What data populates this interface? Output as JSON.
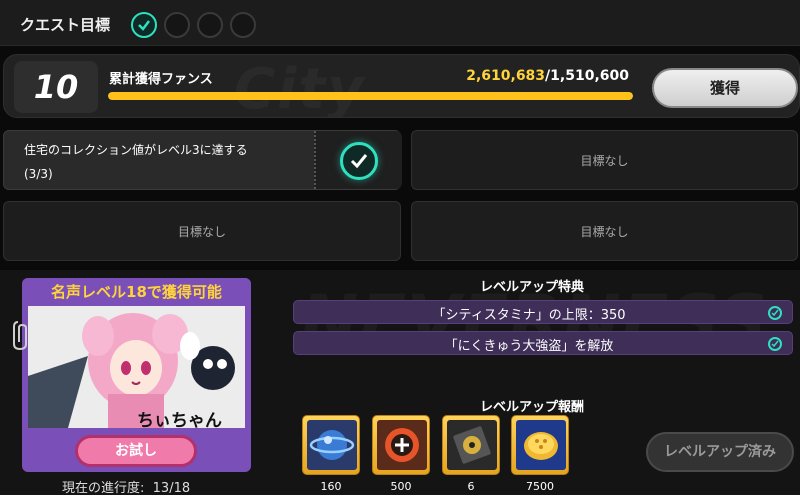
{
  "quest": {
    "title": "クエスト目標",
    "dots": [
      {
        "state": "completed",
        "icon": "check-icon"
      },
      {
        "state": "empty"
      },
      {
        "state": "empty"
      },
      {
        "state": "empty"
      }
    ]
  },
  "fans": {
    "level": "10",
    "label": "累計獲得ファンス",
    "current": "2,610,683",
    "required": "/1,510,600",
    "progress": 1.0,
    "claim_label": "獲得",
    "accent_color": "#ffc21a"
  },
  "goals": [
    {
      "text": "住宅のコレクション値がレベル3に達する",
      "progress": "(3/3)",
      "completed": true
    },
    {
      "text": "目標なし"
    },
    {
      "text": "目標なし"
    },
    {
      "text": "目標なし"
    }
  ],
  "character": {
    "unlock_label": "名声レベル18で獲得可能",
    "name": "ちぃちゃん",
    "try_label": "お試し",
    "progress_label": "現在の進行度:",
    "progress_value": "13/18"
  },
  "perks": {
    "title": "レベルアップ特典",
    "items": [
      {
        "label": "「シティスタミナ」の上限：350",
        "icon": "check-icon"
      },
      {
        "label": "「にくきゅう大強盗」を解放",
        "icon": "check-icon"
      }
    ]
  },
  "rewards": {
    "title": "レベルアップ報酬",
    "items": [
      {
        "icon": "blue-orb-icon",
        "count": "160"
      },
      {
        "icon": "hunter-badge-icon",
        "count": "500"
      },
      {
        "icon": "disc-case-icon",
        "count": "6"
      },
      {
        "icon": "gold-coin-icon",
        "count": "7500"
      }
    ],
    "done_label": "レベルアップ済み"
  }
}
